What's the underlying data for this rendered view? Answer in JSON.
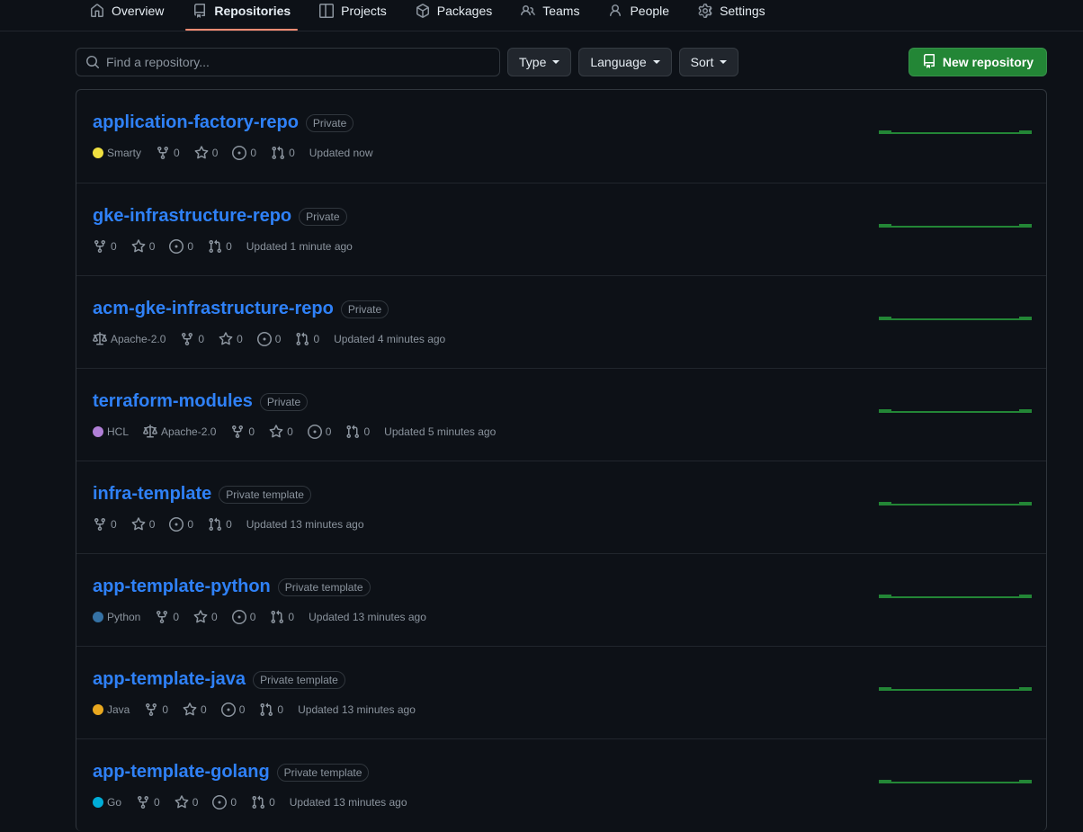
{
  "nav": {
    "tabs": [
      {
        "label": "Overview",
        "icon": "home-icon",
        "active": false
      },
      {
        "label": "Repositories",
        "icon": "repo-icon",
        "active": true
      },
      {
        "label": "Projects",
        "icon": "project-icon",
        "active": false
      },
      {
        "label": "Packages",
        "icon": "package-icon",
        "active": false
      },
      {
        "label": "Teams",
        "icon": "people-icon",
        "active": false
      },
      {
        "label": "People",
        "icon": "person-icon",
        "active": false
      },
      {
        "label": "Settings",
        "icon": "gear-icon",
        "active": false
      }
    ],
    "active_underline_color": "#fd8c73"
  },
  "filters": {
    "search": {
      "value": "",
      "placeholder": "Find a repository...",
      "icon": "search-icon"
    },
    "type": {
      "label": "Type"
    },
    "language": {
      "label": "Language"
    },
    "sort": {
      "label": "Sort"
    },
    "new_repo": {
      "label": "New repository",
      "icon": "repo-icon",
      "color": "#238636"
    }
  },
  "repos": [
    {
      "name": "application-factory-repo",
      "visibility": "Private",
      "language": "Smarty",
      "language_color": "#f0e040",
      "license": null,
      "forks": "0",
      "stars": "0",
      "issues": "0",
      "pulls": "0",
      "updated": "Updated now",
      "graph_color": "#238636"
    },
    {
      "name": "gke-infrastructure-repo",
      "visibility": "Private",
      "language": null,
      "language_color": null,
      "license": null,
      "forks": "0",
      "stars": "0",
      "issues": "0",
      "pulls": "0",
      "updated": "Updated 1 minute ago",
      "graph_color": "#238636"
    },
    {
      "name": "acm-gke-infrastructure-repo",
      "visibility": "Private",
      "language": null,
      "language_color": null,
      "license": "Apache-2.0",
      "forks": "0",
      "stars": "0",
      "issues": "0",
      "pulls": "0",
      "updated": "Updated 4 minutes ago",
      "graph_color": "#238636"
    },
    {
      "name": "terraform-modules",
      "visibility": "Private",
      "language": "HCL",
      "language_color": "#b07fd6",
      "license": "Apache-2.0",
      "forks": "0",
      "stars": "0",
      "issues": "0",
      "pulls": "0",
      "updated": "Updated 5 minutes ago",
      "graph_color": "#238636"
    },
    {
      "name": "infra-template",
      "visibility": "Private template",
      "language": null,
      "language_color": null,
      "license": null,
      "forks": "0",
      "stars": "0",
      "issues": "0",
      "pulls": "0",
      "updated": "Updated 13 minutes ago",
      "graph_color": "#238636"
    },
    {
      "name": "app-template-python",
      "visibility": "Private template",
      "language": "Python",
      "language_color": "#3572A5",
      "license": null,
      "forks": "0",
      "stars": "0",
      "issues": "0",
      "pulls": "0",
      "updated": "Updated 13 minutes ago",
      "graph_color": "#238636"
    },
    {
      "name": "app-template-java",
      "visibility": "Private template",
      "language": "Java",
      "language_color": "#e9a81f",
      "license": null,
      "forks": "0",
      "stars": "0",
      "issues": "0",
      "pulls": "0",
      "updated": "Updated 13 minutes ago",
      "graph_color": "#238636"
    },
    {
      "name": "app-template-golang",
      "visibility": "Private template",
      "language": "Go",
      "language_color": "#00ADD8",
      "license": null,
      "forks": "0",
      "stars": "0",
      "issues": "0",
      "pulls": "0",
      "updated": "Updated 13 minutes ago",
      "graph_color": "#238636"
    }
  ]
}
